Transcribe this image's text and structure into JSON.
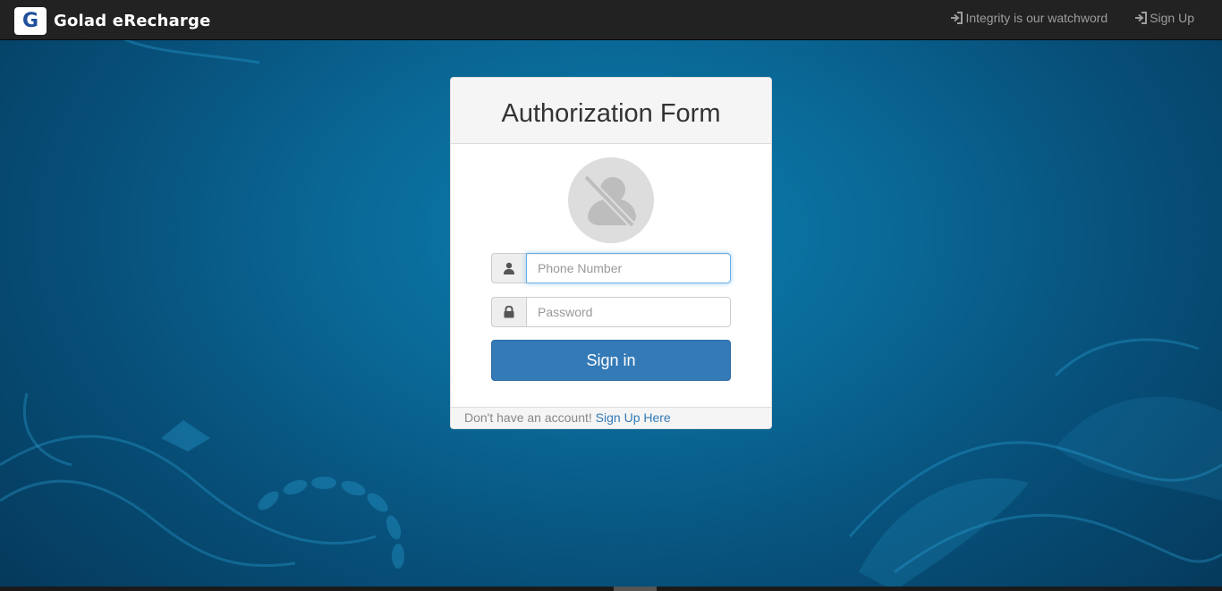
{
  "navbar": {
    "logo_letter": "G",
    "brand": "Golad eRecharge",
    "links": [
      {
        "label": "Integrity is our watchword",
        "icon": "sign-in-icon"
      },
      {
        "label": "Sign Up",
        "icon": "sign-in-icon"
      }
    ]
  },
  "form": {
    "title": "Authorization Form",
    "avatar_icon": "user-disabled-icon",
    "phone": {
      "placeholder": "Phone Number",
      "value": "",
      "icon": "user-icon"
    },
    "password": {
      "placeholder": "Password",
      "value": "",
      "icon": "lock-icon"
    },
    "submit_label": "Sign in",
    "footer_text": "Don't have an account!",
    "footer_link": "Sign Up Here"
  },
  "colors": {
    "navbar_bg": "#222222",
    "primary": "#337ab7",
    "background": "#0a6896"
  }
}
